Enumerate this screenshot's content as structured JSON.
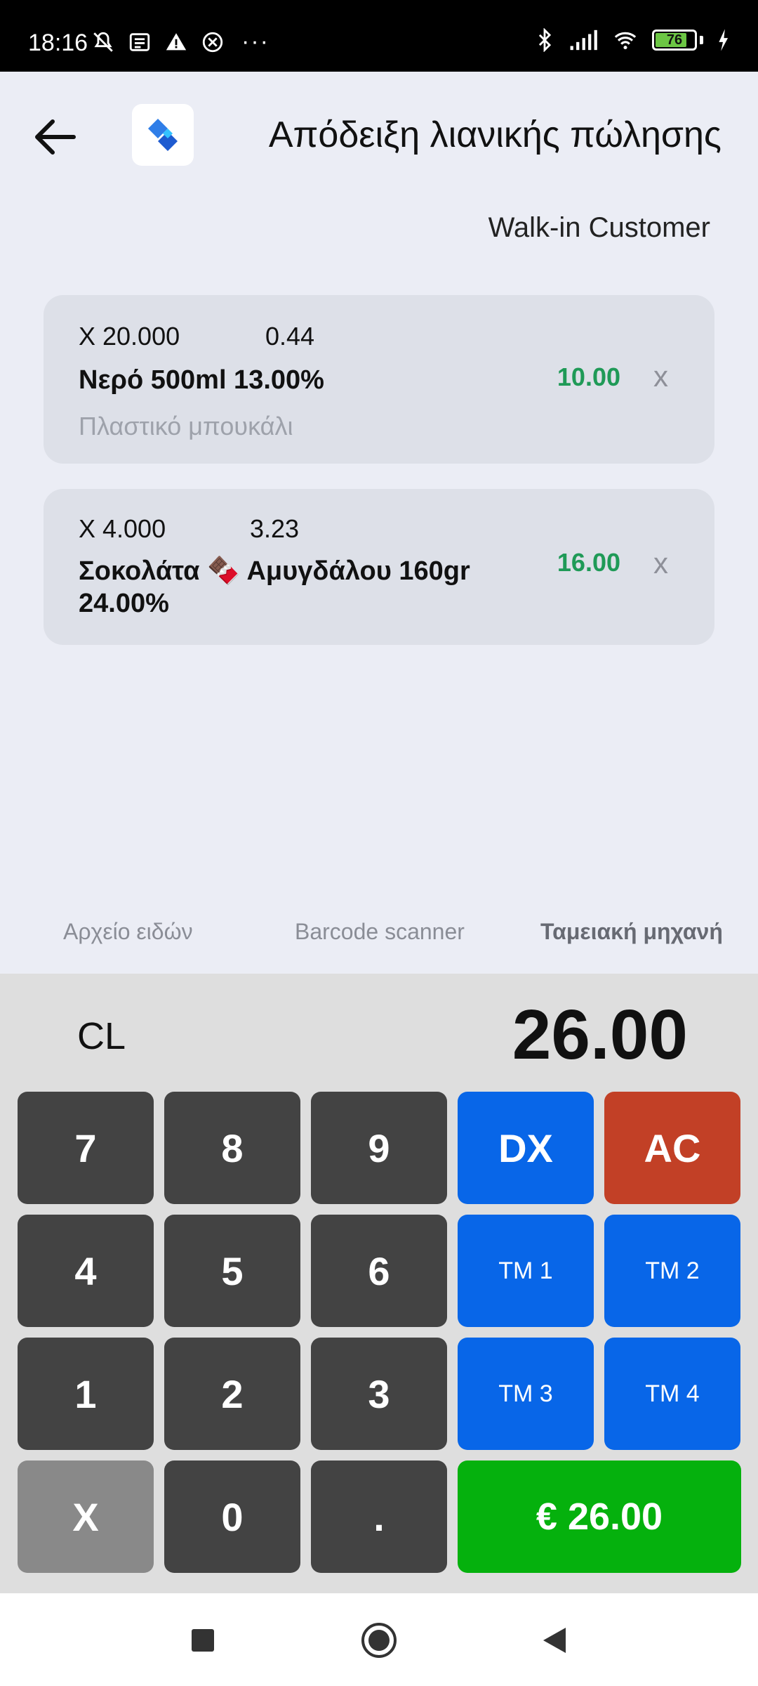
{
  "status_bar": {
    "time": "18:16",
    "more": "···",
    "battery_level": "76"
  },
  "header": {
    "title": "Απόδειξη λιανικής πώλησης",
    "customer": "Walk-in Customer"
  },
  "items": [
    {
      "qty": "X 20.000",
      "unit_price": "0.44",
      "name": "Νερό 500ml  13.00%",
      "description": "Πλαστικό μπουκάλι",
      "total": "10.00",
      "remove": "x"
    },
    {
      "qty": "X 4.000",
      "unit_price": "3.23",
      "name_line1": "Σοκολάτα 🍫 Αμυγδάλου 160gr",
      "name_line2": "24.00%",
      "total": "16.00",
      "remove": "x"
    }
  ],
  "tabs": [
    {
      "label": "Αρχείο ειδών"
    },
    {
      "label": "Barcode scanner"
    },
    {
      "label": "Ταμειακή μηχανή",
      "active": true
    }
  ],
  "keypad": {
    "mode_label": "CL",
    "display_value": "26.00",
    "keys": {
      "k7": "7",
      "k8": "8",
      "k9": "9",
      "dx": "DX",
      "ac": "AC",
      "k4": "4",
      "k5": "5",
      "k6": "6",
      "tm1": "TM 1",
      "tm2": "TM 2",
      "k1": "1",
      "k2": "2",
      "k3": "3",
      "tm3": "TM 3",
      "tm4": "TM 4",
      "x": "X",
      "k0": "0",
      "dot": ".",
      "pay": "€ 26.00"
    }
  },
  "colors": {
    "accent_blue": "#0866e8",
    "pay_green": "#05b10d",
    "clear_red": "#c24026",
    "total_green": "#1f9a57"
  }
}
